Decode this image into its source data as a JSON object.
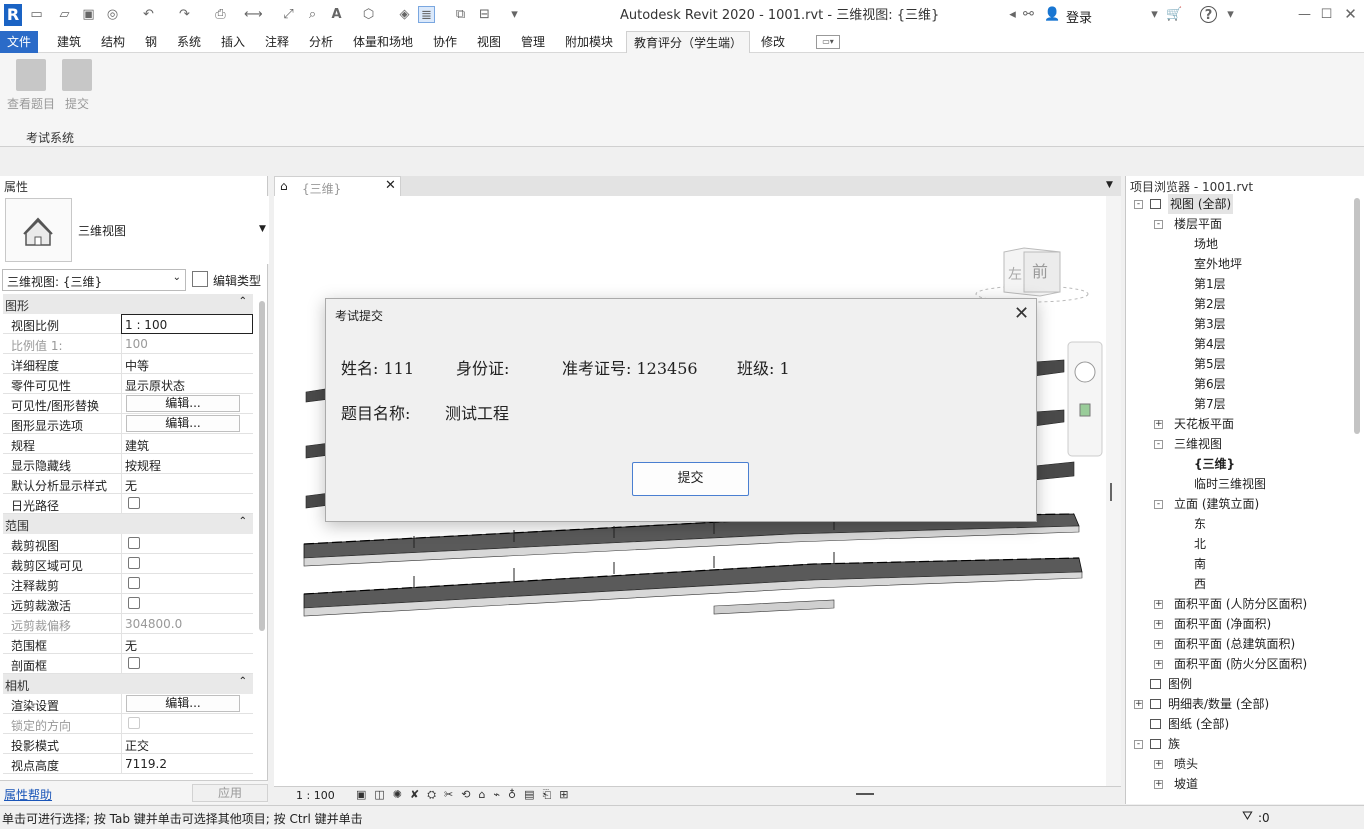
{
  "app": {
    "window_title": "Autodesk Revit 2020 - 1001.rvt - 三维视图: {三维}",
    "logo_letter": "R",
    "login_label": "登录"
  },
  "tabs": [
    "文件",
    "建筑",
    "结构",
    "钢",
    "系统",
    "插入",
    "注释",
    "分析",
    "体量和场地",
    "协作",
    "视图",
    "管理",
    "附加模块",
    "教育评分（学生端）",
    "修改"
  ],
  "ribbon": {
    "buttons": [
      {
        "label": "查看题目"
      },
      {
        "label": "提交"
      }
    ],
    "panel_label": "考试系统"
  },
  "properties": {
    "header": "属性",
    "type_name": "三维视图",
    "instance_selector": "三维视图: {三维}",
    "edit_type_label": "编辑类型",
    "sections": [
      {
        "title": "图形",
        "rows": [
          {
            "key": "视图比例",
            "value": "1 : 100",
            "kind": "input"
          },
          {
            "key": "比例值 1:",
            "value": "100",
            "kind": "dim"
          },
          {
            "key": "详细程度",
            "value": "中等"
          },
          {
            "key": "零件可见性",
            "value": "显示原状态"
          },
          {
            "key": "可见性/图形替换",
            "value": "编辑...",
            "kind": "button"
          },
          {
            "key": "图形显示选项",
            "value": "编辑...",
            "kind": "button"
          },
          {
            "key": "规程",
            "value": "建筑"
          },
          {
            "key": "显示隐藏线",
            "value": "按规程"
          },
          {
            "key": "默认分析显示样式",
            "value": "无"
          },
          {
            "key": "日光路径",
            "value": "",
            "kind": "checkbox"
          }
        ]
      },
      {
        "title": "范围",
        "rows": [
          {
            "key": "裁剪视图",
            "value": "",
            "kind": "checkbox"
          },
          {
            "key": "裁剪区域可见",
            "value": "",
            "kind": "checkbox"
          },
          {
            "key": "注释裁剪",
            "value": "",
            "kind": "checkbox"
          },
          {
            "key": "远剪裁激活",
            "value": "",
            "kind": "checkbox"
          },
          {
            "key": "远剪裁偏移",
            "value": "304800.0",
            "kind": "dim"
          },
          {
            "key": "范围框",
            "value": "无"
          },
          {
            "key": "剖面框",
            "value": "",
            "kind": "checkbox"
          }
        ]
      },
      {
        "title": "相机",
        "rows": [
          {
            "key": "渲染设置",
            "value": "编辑...",
            "kind": "button"
          },
          {
            "key": "锁定的方向",
            "value": "",
            "kind": "checkbox-dim"
          },
          {
            "key": "投影模式",
            "value": "正交"
          },
          {
            "key": "视点高度",
            "value": "7119.2"
          }
        ]
      }
    ],
    "help_link": "属性帮助",
    "apply_label": "应用"
  },
  "view": {
    "tab_title": "{三维}",
    "viewcube_face": "前",
    "viewcube_side": "左",
    "scale": "1 : 100"
  },
  "browser": {
    "header": "项目浏览器 - 1001.rvt",
    "items": [
      {
        "label": "视图 (全部)",
        "level": 0,
        "toggle": "-",
        "selected": true
      },
      {
        "label": "楼层平面",
        "level": 1,
        "toggle": "-"
      },
      {
        "label": "场地",
        "level": 2
      },
      {
        "label": "室外地坪",
        "level": 2
      },
      {
        "label": "第1层",
        "level": 2
      },
      {
        "label": "第2层",
        "level": 2
      },
      {
        "label": "第3层",
        "level": 2
      },
      {
        "label": "第4层",
        "level": 2
      },
      {
        "label": "第5层",
        "level": 2
      },
      {
        "label": "第6层",
        "level": 2
      },
      {
        "label": "第7层",
        "level": 2
      },
      {
        "label": "天花板平面",
        "level": 1,
        "toggle": "+"
      },
      {
        "label": "三维视图",
        "level": 1,
        "toggle": "-"
      },
      {
        "label": "{三维}",
        "level": 2,
        "bold": true
      },
      {
        "label": "临时三维视图",
        "level": 2
      },
      {
        "label": "立面 (建筑立面)",
        "level": 1,
        "toggle": "-"
      },
      {
        "label": "东",
        "level": 2
      },
      {
        "label": "北",
        "level": 2
      },
      {
        "label": "南",
        "level": 2
      },
      {
        "label": "西",
        "level": 2
      },
      {
        "label": "面积平面 (人防分区面积)",
        "level": 1,
        "toggle": "+"
      },
      {
        "label": "面积平面 (净面积)",
        "level": 1,
        "toggle": "+"
      },
      {
        "label": "面积平面 (总建筑面积)",
        "level": 1,
        "toggle": "+"
      },
      {
        "label": "面积平面 (防火分区面积)",
        "level": 1,
        "toggle": "+"
      },
      {
        "label": "图例",
        "level": 0
      },
      {
        "label": "明细表/数量 (全部)",
        "level": 0,
        "toggle": "+"
      },
      {
        "label": "图纸 (全部)",
        "level": 0
      },
      {
        "label": "族",
        "level": 0,
        "toggle": "-"
      },
      {
        "label": "喷头",
        "level": 1,
        "toggle": "+"
      },
      {
        "label": "坡道",
        "level": 1,
        "toggle": "+"
      }
    ]
  },
  "dialog": {
    "title": "考试提交",
    "name_label": "姓名: 111",
    "id_label": "身份证:",
    "exam_no_label": "准考证号: 123456",
    "class_label": "班级: 1",
    "subject_label": "题目名称:",
    "subject_value": "测试工程",
    "submit_label": "提交"
  },
  "statusbar": {
    "hint": "单击可进行选择; 按 Tab 键并单击可选择其他项目; 按 Ctrl 键并单击",
    "filter_count": ":0"
  }
}
